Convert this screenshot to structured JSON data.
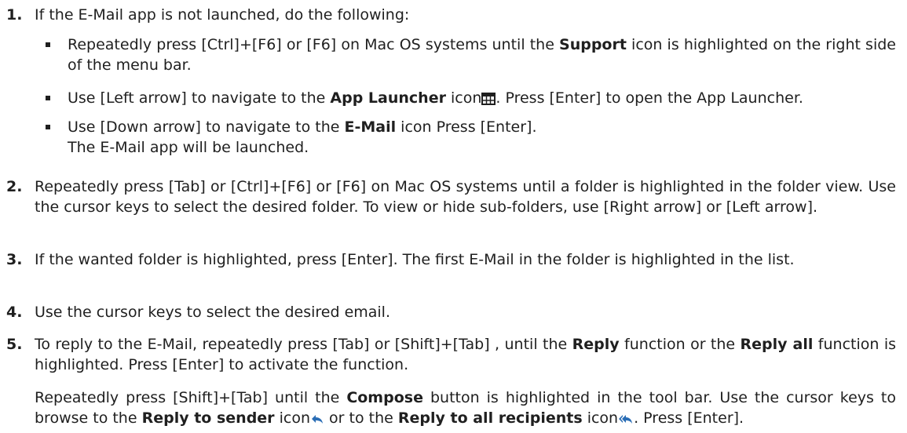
{
  "steps": [
    {
      "number": "1.",
      "text": "If the E-Mail app is not launched, do the following:",
      "bullets": [
        {
          "pre": "Repeatedly press [Ctrl]+[F6] or [F6] on Mac OS systems until the ",
          "bold": "Support",
          "post": " icon is highlighted on the right side of the menu bar."
        },
        {
          "pre": "Use [Left arrow] to navigate to the ",
          "bold": "App Launcher",
          "mid": " icon",
          "icon": "app-launcher-grid-icon",
          "post": ". Press [Enter] to open the App Launcher."
        },
        {
          "pre": "Use [Down arrow] to navigate to the ",
          "bold": "E-Mail",
          "post": " icon Press [Enter].",
          "line2": "The E-Mail app will be launched."
        }
      ]
    },
    {
      "number": "2.",
      "text": "Repeatedly press [Tab] or [Ctrl]+[F6] or [F6] on Mac OS systems until a folder is highlighted in the folder view. Use the cursor keys to select the desired folder. To view or hide sub-folders, use [Right arrow] or [Left arrow]."
    },
    {
      "number": "3.",
      "text": "If the wanted folder is highlighted, press [Enter]. The first E-Mail in the folder is highlighted in the list."
    },
    {
      "number": "4.",
      "text": "Use the cursor keys to select the desired email."
    },
    {
      "number": "5.",
      "p1": {
        "a": "To reply to the E-Mail, repeatedly press [Tab] or [Shift]+[Tab] , until the ",
        "b": "Reply",
        "c": " function or the ",
        "d": "Reply all",
        "e": " function is highlighted. Press [Enter] to activate the function."
      },
      "p2": {
        "a": "Repeatedly press [Shift]+[Tab] until the ",
        "b": "Compose",
        "c": " button is highlighted in the tool bar. Use the cursor keys to browse to the ",
        "d": "Reply to sender",
        "e": " icon",
        "icon1": "reply-icon",
        "f": " or to the ",
        "g": "Reply to all recipients",
        "h": " icon",
        "icon2": "reply-all-icon",
        "i": ". Press [Enter]."
      }
    }
  ],
  "colors": {
    "text": "#1f1f1f",
    "icon": "#2a6db5"
  }
}
